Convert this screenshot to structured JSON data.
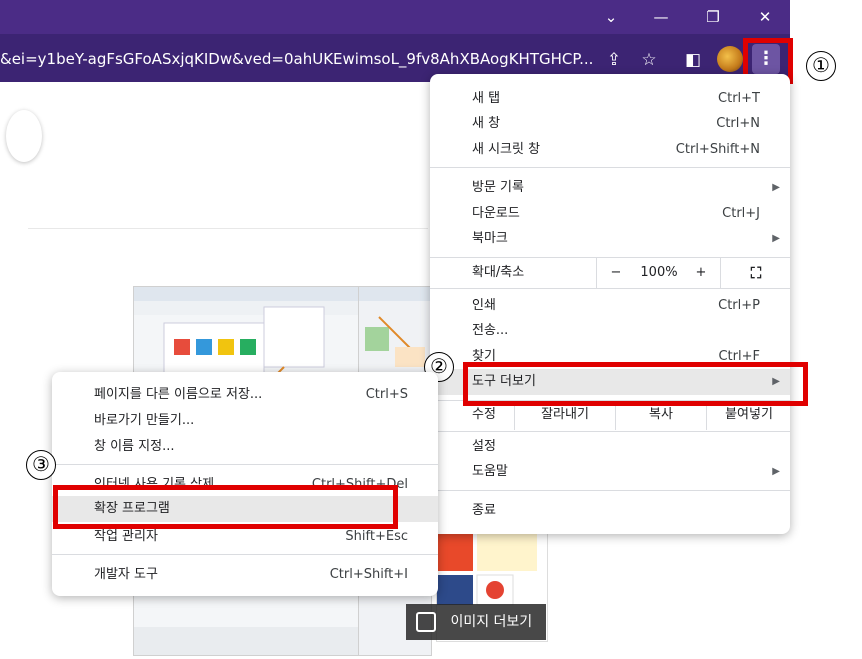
{
  "window": {
    "min_glyph": "—",
    "restore_glyph": "❐",
    "close_glyph": "✕",
    "tabs_glyph": "⌄"
  },
  "toolbar": {
    "url": "&ei=y1beY-agFsGFoASxjqKIDw&ved=0ahUKEwimsoL_9fv8AhXBAogKHTGHCP...",
    "share_glyph": "⇪",
    "star_glyph": "☆",
    "sidepanel_glyph": "◧",
    "menu_glyph": "⋮"
  },
  "steps": {
    "one": "①",
    "two": "②",
    "three": "③"
  },
  "page": {
    "more_images": "이미지 더보기",
    "image_glyph": "🖼"
  },
  "menu": {
    "new_tab": "새 탭",
    "new_tab_sc": "Ctrl+T",
    "new_window": "새 창",
    "new_window_sc": "Ctrl+N",
    "incognito": "새 시크릿 창",
    "incognito_sc": "Ctrl+Shift+N",
    "history": "방문 기록",
    "downloads": "다운로드",
    "downloads_sc": "Ctrl+J",
    "bookmarks": "북마크",
    "zoom": "확대/축소",
    "zoom_minus": "−",
    "zoom_value": "100%",
    "zoom_plus": "+",
    "fullscreen_glyph": "⛶",
    "print": "인쇄",
    "print_sc": "Ctrl+P",
    "cast": "전송...",
    "find": "찾기",
    "find_sc": "Ctrl+F",
    "more_tools": "도구 더보기",
    "edit": "수정",
    "cut": "잘라내기",
    "copy": "복사",
    "paste": "붙여넣기",
    "settings": "설정",
    "help": "도움말",
    "exit": "종료",
    "arrow": "▶"
  },
  "submenu": {
    "save_page": "페이지를 다른 이름으로 저장...",
    "save_page_sc": "Ctrl+S",
    "create_shortcut": "바로가기 만들기...",
    "name_window": "창 이름 지정...",
    "clear_data": "인터넷 사용 기록 삭제...",
    "clear_data_sc": "Ctrl+Shift+Del",
    "extensions": "확장 프로그램",
    "task_manager": "작업 관리자",
    "task_manager_sc": "Shift+Esc",
    "dev_tools": "개발자 도구",
    "dev_tools_sc": "Ctrl+Shift+I"
  }
}
